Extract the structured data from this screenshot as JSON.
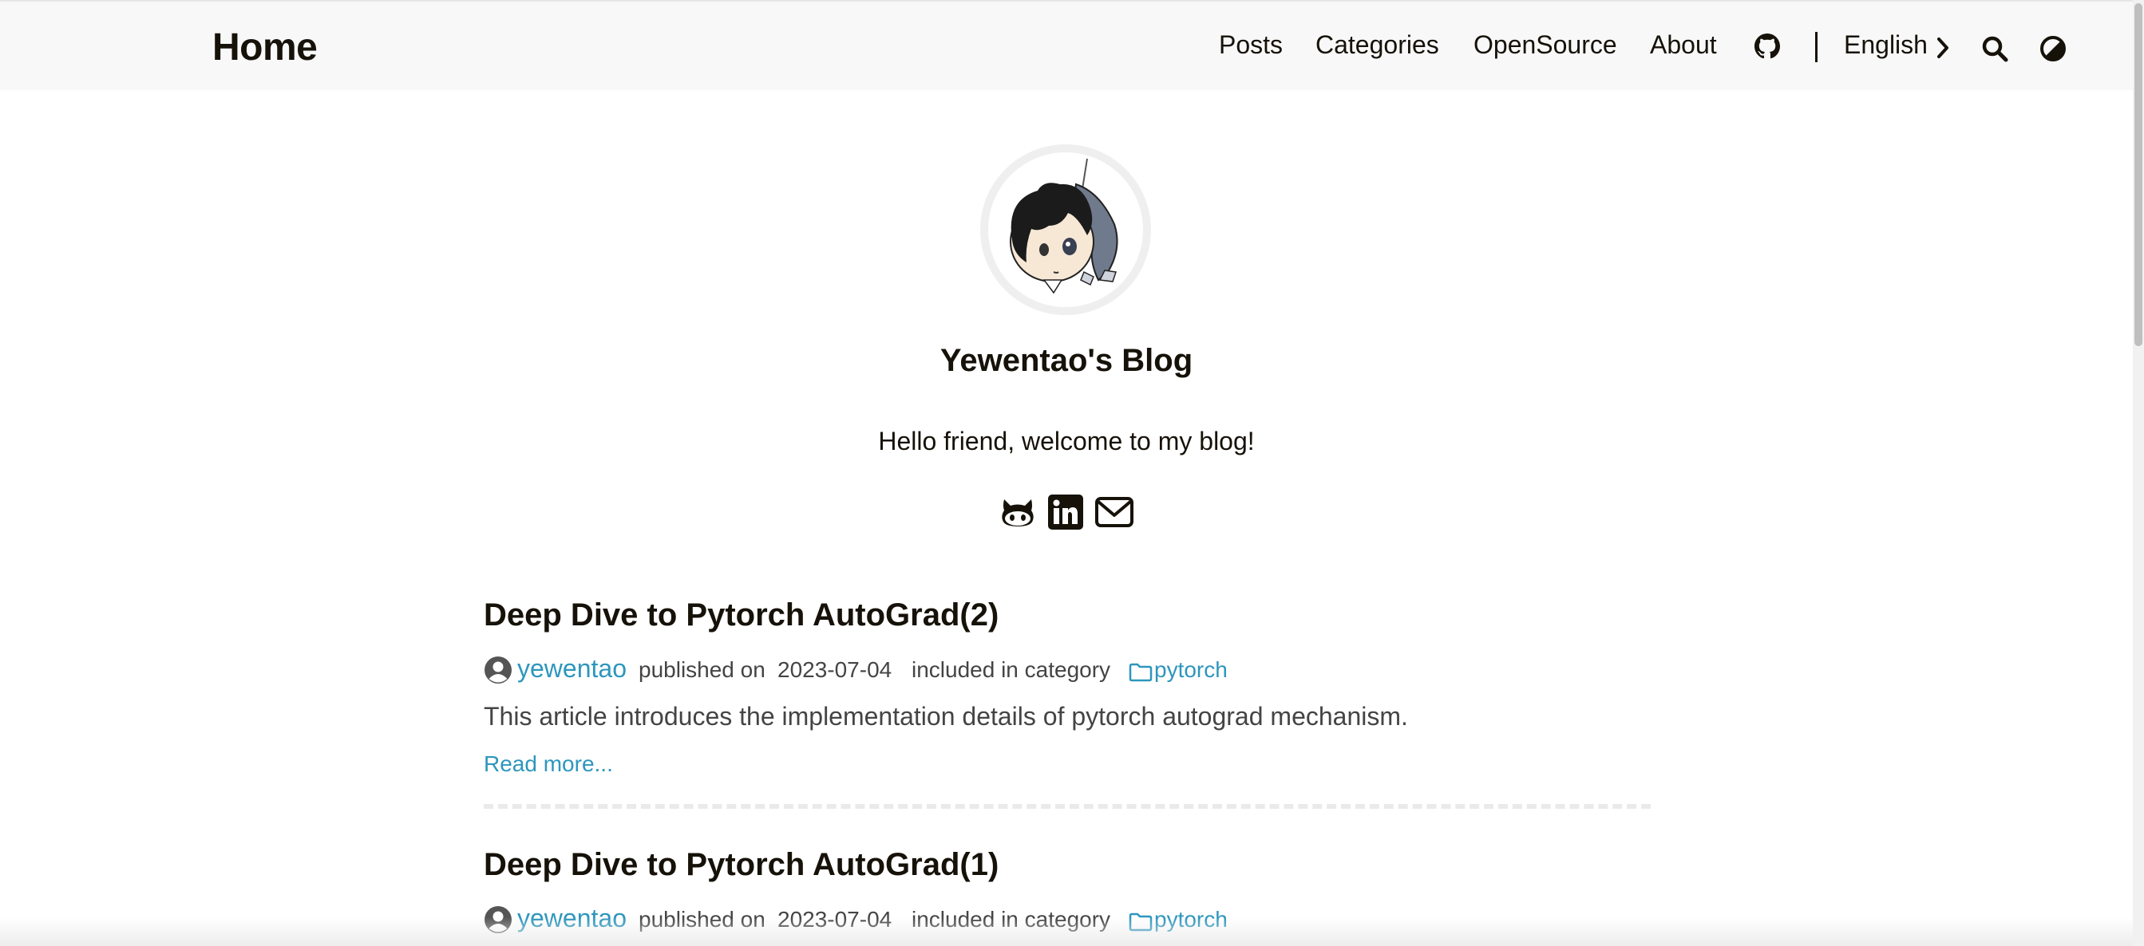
{
  "header": {
    "logo": "Home",
    "nav": {
      "posts": "Posts",
      "categories": "Categories",
      "opensource": "OpenSource",
      "about": "About",
      "language": "English"
    },
    "icons": [
      "github-icon",
      "chevron-right-icon",
      "search-icon",
      "theme-toggle-icon"
    ]
  },
  "profile": {
    "title": "Yewentao's Blog",
    "subtitle": "Hello friend, welcome to my blog!",
    "social_icons": [
      "github-icon",
      "linkedin-icon",
      "email-icon"
    ]
  },
  "posts": [
    {
      "title": "Deep Dive to Pytorch AutoGrad(2)",
      "author": "yewentao",
      "published_text": "published on",
      "date": "2023-07-04",
      "category_text": "included in category",
      "category": "pytorch",
      "summary": "This article introduces the implementation details of pytorch autograd mechanism.",
      "read_more": "Read more..."
    },
    {
      "title": "Deep Dive to Pytorch AutoGrad(1)",
      "author": "yewentao",
      "published_text": "published on",
      "date": "2023-07-04",
      "category_text": "included in category",
      "category": "pytorch"
    }
  ],
  "colors": {
    "header_bg": "#f8f8f8",
    "text": "#161209",
    "link": "#2d96bd",
    "meta_text": "#444444"
  }
}
